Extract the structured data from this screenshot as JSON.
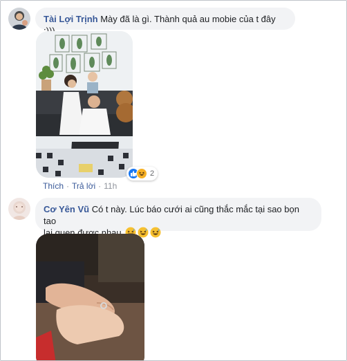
{
  "comments": [
    {
      "author": "Tài Lợi Trịnh",
      "text": "Mày đã là gì. Thành quả au mobie của t đây :)))",
      "photo_icon": "family-photo",
      "reactions": {
        "icons": [
          "like-icon",
          "haha-icon"
        ],
        "count": "2"
      },
      "actions": {
        "like": "Thích",
        "reply": "Trả lời",
        "time": "11h"
      }
    },
    {
      "author": "Cơ Yên Vũ",
      "text_line1": "Có t này. Lúc báo cưới ai cũng thắc mắc tại sao bọn tao",
      "text_line2": "lại quen được nhau",
      "emoji": [
        "grinning-sweat-emoji",
        "grinning-sweat-emoji",
        "grinning-sweat-emoji"
      ],
      "photo_icon": "holding-hands-photo"
    }
  ],
  "colors": {
    "author_link": "#385898",
    "bubble_bg": "#f2f3f5",
    "like_blue": "#1877f2",
    "haha_yellow": "#f7b125"
  }
}
